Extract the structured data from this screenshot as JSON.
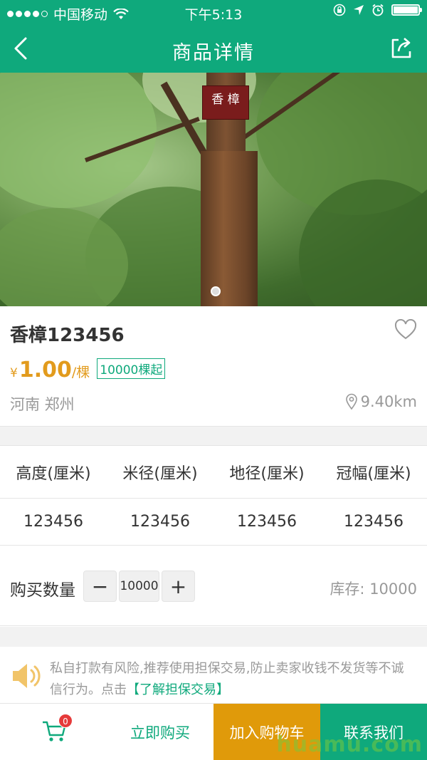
{
  "status_bar": {
    "carrier": "中国移动",
    "time": "下午5:13"
  },
  "header": {
    "title": "商品详情",
    "back_icon": "chevron-left-icon",
    "share_icon": "share-icon"
  },
  "hero": {
    "sign_text": "香 樟"
  },
  "product": {
    "name": "香樟123456",
    "price_symbol": "¥",
    "price": "1.00",
    "unit": "/棵",
    "min_order": "10000棵起",
    "location": "河南 郑州",
    "distance": "9.40km"
  },
  "specs": {
    "headers": [
      "高度(厘米)",
      "米径(厘米)",
      "地径(厘米)",
      "冠幅(厘米)"
    ],
    "values": [
      "123456",
      "123456",
      "123456",
      "123456"
    ]
  },
  "quantity": {
    "label": "购买数量",
    "value": "10000",
    "minus": "−",
    "plus": "+",
    "stock": "库存:  10000"
  },
  "notice": {
    "text": "私自打款有风险,推荐使用担保交易,防止卖家收钱不发货等不诚信行为。点击",
    "link": "【了解担保交易】"
  },
  "bottom_bar": {
    "cart_badge": "0",
    "buy_now": "立即购买",
    "add_to_cart": "加入购物车",
    "contact": "联系我们"
  },
  "watermark": "huamu.com",
  "colors": {
    "brand_green": "#0fa97c",
    "price_orange": "#e29b1d",
    "cart_orange": "#e09a0a",
    "badge_red": "#e63a3a"
  }
}
